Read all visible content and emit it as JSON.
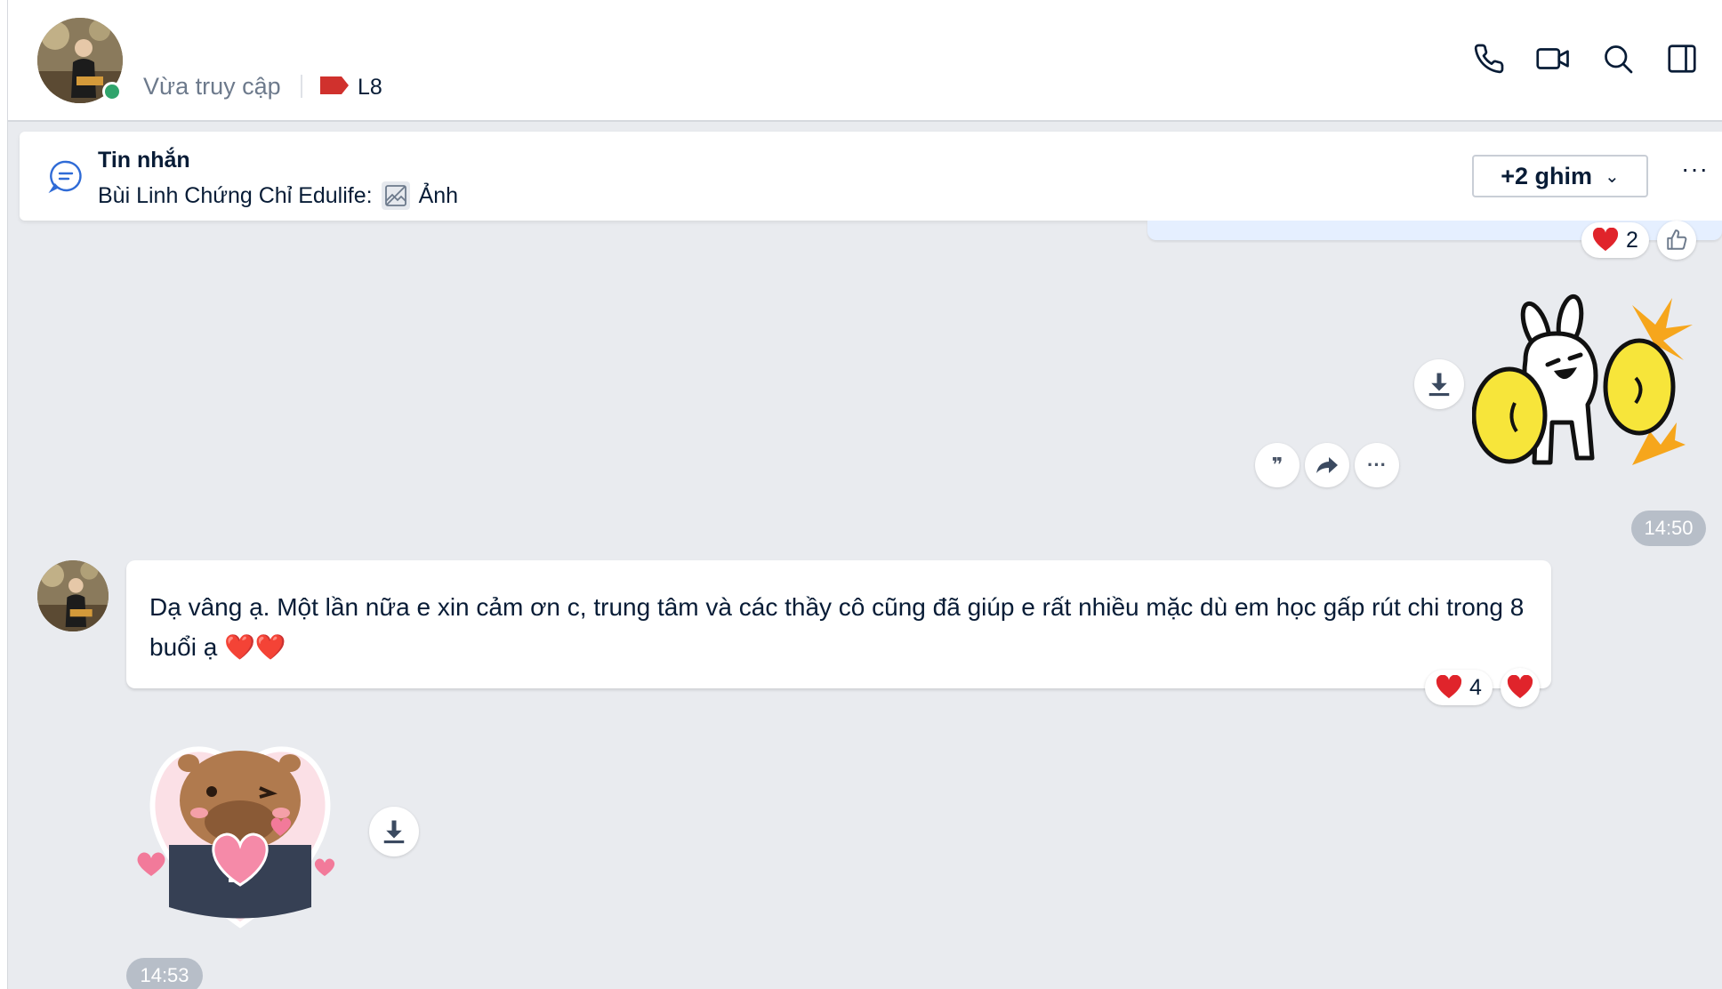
{
  "header": {
    "status": "Vừa truy cập",
    "tag_label": "L8",
    "tag_color": "#d0312d",
    "online_color": "#30a46c",
    "buttons": [
      "phone-icon",
      "video-icon",
      "search-icon",
      "sidebar-toggle-icon"
    ]
  },
  "pinned": {
    "title": "Tin nhắn",
    "sender": "Bùi Linh Chứng Chỉ Edulife:",
    "content": "Ảnh",
    "pin_button": "+2 ghim",
    "more": "···"
  },
  "messages": {
    "prev_reaction_count": "2",
    "sticker1_time": "14:50",
    "text_message": "Dạ vâng ạ. Một lần nữa e xin cảm ơn c, trung tâm và các thầy cô cũng đã giúp e rất nhiều mặc dù em học gấp rút chi trong 8 buổi ạ ❤️❤️",
    "text_reaction_count": "4",
    "sticker2_time": "14:53",
    "action_more": "···"
  },
  "colors": {
    "background": "#e9ebef",
    "bubble_own": "#e5efff",
    "time_pill": "#b7bec8",
    "heart": "#e0242b"
  }
}
